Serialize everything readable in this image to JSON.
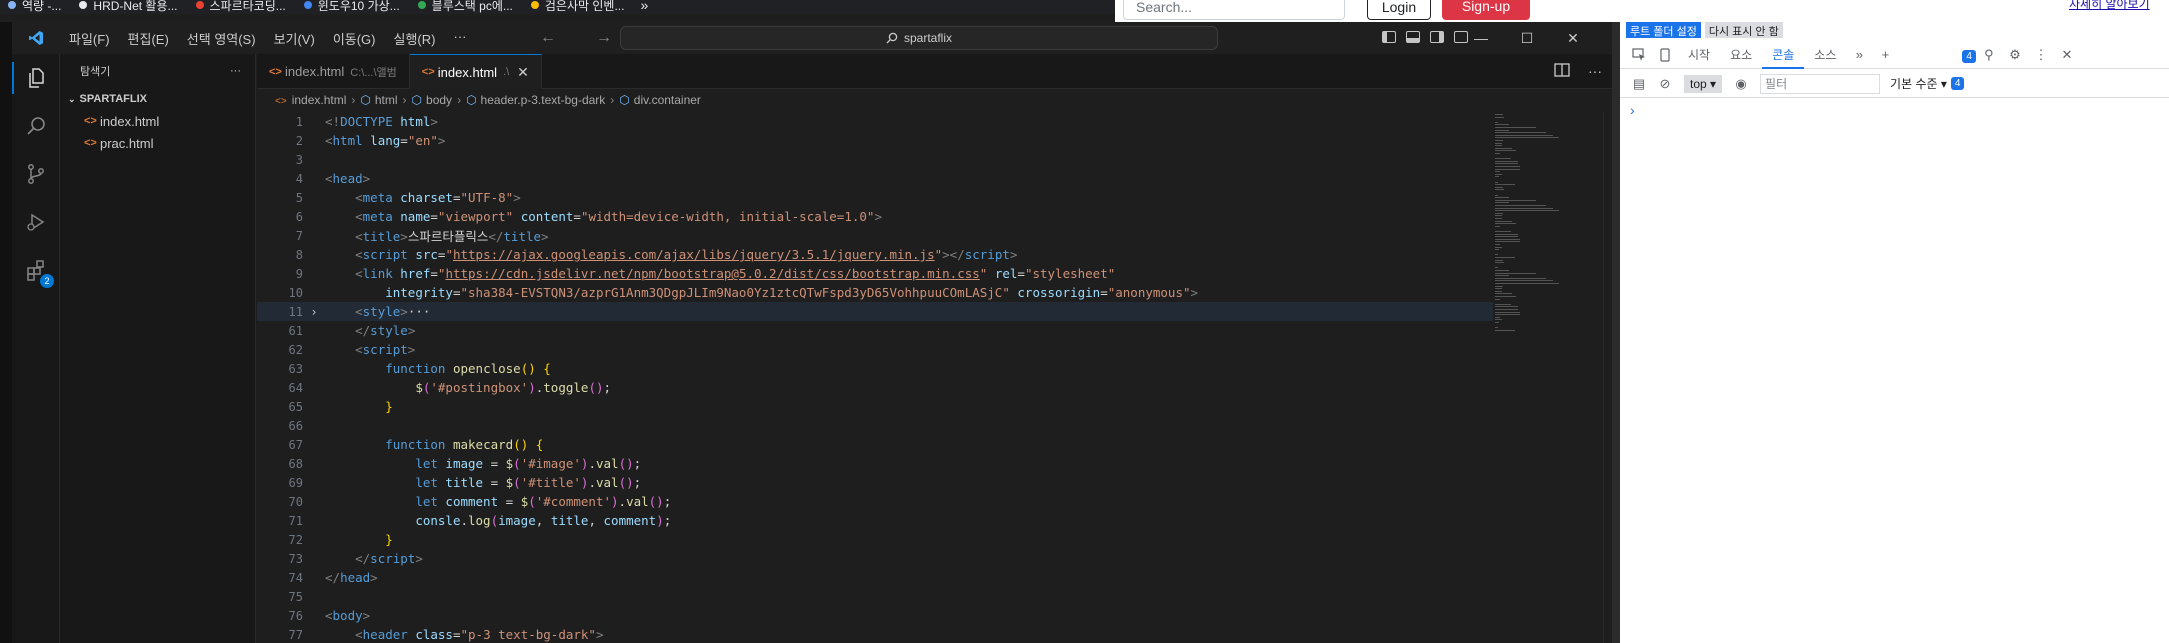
{
  "browser": {
    "bookmarks": [
      {
        "label": "역량 -...",
        "color": "#8ab4f8"
      },
      {
        "label": "HRD-Net 활용...",
        "color": "#e8eaed"
      },
      {
        "label": "스파르타코딩...",
        "color": "#ea4335"
      },
      {
        "label": "윈도우10 가상...",
        "color": "#4285f4"
      },
      {
        "label": "블루스택 pc에...",
        "color": "#34a853"
      },
      {
        "label": "검은사막 인벤...",
        "color": "#fbbc04"
      }
    ],
    "bookmarks_more": "»"
  },
  "webpage": {
    "search_placeholder": "Search...",
    "login_label": "Login",
    "signup_label": "Sign-up",
    "learn_more": "자세히 알아보기"
  },
  "vscode": {
    "menu": [
      "파일(F)",
      "편집(E)",
      "선택 영역(S)",
      "보기(V)",
      "이동(G)",
      "실행(R)",
      "···"
    ],
    "command_center": "spartaflix",
    "window_controls": [
      "—",
      "☐",
      "✕"
    ],
    "extensions_badge": "2",
    "sidebar": {
      "title": "탐색기",
      "more": "···",
      "folder": "SPARTAFLIX",
      "files": [
        "index.html",
        "prac.html"
      ]
    },
    "tabs": [
      {
        "label": "index.html",
        "desc": "C:\\...\\앨범",
        "active": false
      },
      {
        "label": "index.html",
        "desc": ".\\",
        "active": true
      }
    ],
    "tab_close": "✕",
    "breadcrumb": [
      "index.html",
      "html",
      "body",
      "header.p-3.text-bg-dark",
      "div.container"
    ],
    "code_lines": [
      {
        "n": "1",
        "fold": "",
        "hl": false,
        "parts": [
          [
            "t-brk",
            "<!"
          ],
          [
            "t-tag",
            "DOCTYPE"
          ],
          [
            "t-txt",
            " "
          ],
          [
            "t-attr",
            "html"
          ],
          [
            "t-brk",
            ">"
          ]
        ]
      },
      {
        "n": "2",
        "fold": "",
        "hl": false,
        "parts": [
          [
            "t-brk",
            "<"
          ],
          [
            "t-tag",
            "html"
          ],
          [
            "t-txt",
            " "
          ],
          [
            "t-attr",
            "lang"
          ],
          [
            "t-txt",
            "="
          ],
          [
            "t-str",
            "\"en\""
          ],
          [
            "t-brk",
            ">"
          ]
        ]
      },
      {
        "n": "3",
        "fold": "",
        "hl": false,
        "parts": []
      },
      {
        "n": "4",
        "fold": "",
        "hl": false,
        "parts": [
          [
            "t-brk",
            "<"
          ],
          [
            "t-tag",
            "head"
          ],
          [
            "t-brk",
            ">"
          ]
        ]
      },
      {
        "n": "5",
        "fold": "",
        "hl": false,
        "parts": [
          [
            "t-txt",
            "    "
          ],
          [
            "t-brk",
            "<"
          ],
          [
            "t-tag",
            "meta"
          ],
          [
            "t-txt",
            " "
          ],
          [
            "t-attr",
            "charset"
          ],
          [
            "t-txt",
            "="
          ],
          [
            "t-str",
            "\"UTF-8\""
          ],
          [
            "t-brk",
            ">"
          ]
        ]
      },
      {
        "n": "6",
        "fold": "",
        "hl": false,
        "parts": [
          [
            "t-txt",
            "    "
          ],
          [
            "t-brk",
            "<"
          ],
          [
            "t-tag",
            "meta"
          ],
          [
            "t-txt",
            " "
          ],
          [
            "t-attr",
            "name"
          ],
          [
            "t-txt",
            "="
          ],
          [
            "t-str",
            "\"viewport\""
          ],
          [
            "t-txt",
            " "
          ],
          [
            "t-attr",
            "content"
          ],
          [
            "t-txt",
            "="
          ],
          [
            "t-str",
            "\"width=device-width, initial-scale=1.0\""
          ],
          [
            "t-brk",
            ">"
          ]
        ]
      },
      {
        "n": "7",
        "fold": "",
        "hl": false,
        "parts": [
          [
            "t-txt",
            "    "
          ],
          [
            "t-brk",
            "<"
          ],
          [
            "t-tag",
            "title"
          ],
          [
            "t-brk",
            ">"
          ],
          [
            "t-txt",
            "스파르타플릭스"
          ],
          [
            "t-brk",
            "</"
          ],
          [
            "t-tag",
            "title"
          ],
          [
            "t-brk",
            ">"
          ]
        ]
      },
      {
        "n": "8",
        "fold": "",
        "hl": false,
        "parts": [
          [
            "t-txt",
            "    "
          ],
          [
            "t-brk",
            "<"
          ],
          [
            "t-tag",
            "script"
          ],
          [
            "t-txt",
            " "
          ],
          [
            "t-attr",
            "src"
          ],
          [
            "t-txt",
            "="
          ],
          [
            "t-str",
            "\""
          ],
          [
            "t-url",
            "https://ajax.googleapis.com/ajax/libs/jquery/3.5.1/jquery.min.js"
          ],
          [
            "t-str",
            "\""
          ],
          [
            "t-brk",
            "></"
          ],
          [
            "t-tag",
            "script"
          ],
          [
            "t-brk",
            ">"
          ]
        ]
      },
      {
        "n": "9",
        "fold": "",
        "hl": false,
        "parts": [
          [
            "t-txt",
            "    "
          ],
          [
            "t-brk",
            "<"
          ],
          [
            "t-tag",
            "link"
          ],
          [
            "t-txt",
            " "
          ],
          [
            "t-attr",
            "href"
          ],
          [
            "t-txt",
            "="
          ],
          [
            "t-str",
            "\""
          ],
          [
            "t-url",
            "https://cdn.jsdelivr.net/npm/bootstrap@5.0.2/dist/css/bootstrap.min.css"
          ],
          [
            "t-str",
            "\""
          ],
          [
            "t-txt",
            " "
          ],
          [
            "t-attr",
            "rel"
          ],
          [
            "t-txt",
            "="
          ],
          [
            "t-str",
            "\"stylesheet\""
          ]
        ]
      },
      {
        "n": "10",
        "fold": "",
        "hl": false,
        "parts": [
          [
            "t-txt",
            "        "
          ],
          [
            "t-attr",
            "integrity"
          ],
          [
            "t-txt",
            "="
          ],
          [
            "t-str",
            "\"sha384-EVSTQN3/azprG1Anm3QDgpJLIm9Nao0Yz1ztcQTwFspd3yD65VohhpuuCOmLASjC\""
          ],
          [
            "t-txt",
            " "
          ],
          [
            "t-attr",
            "crossorigin"
          ],
          [
            "t-txt",
            "="
          ],
          [
            "t-str",
            "\"anonymous\""
          ],
          [
            "t-brk",
            ">"
          ]
        ]
      },
      {
        "n": "11",
        "fold": "›",
        "hl": true,
        "parts": [
          [
            "t-txt",
            "    "
          ],
          [
            "t-brk",
            "<"
          ],
          [
            "t-tag",
            "style"
          ],
          [
            "t-brk",
            ">"
          ],
          [
            "t-txt",
            "···"
          ]
        ]
      },
      {
        "n": "61",
        "fold": "",
        "hl": false,
        "parts": [
          [
            "t-txt",
            "    "
          ],
          [
            "t-brk",
            "</"
          ],
          [
            "t-tag",
            "style"
          ],
          [
            "t-brk",
            ">"
          ]
        ]
      },
      {
        "n": "62",
        "fold": "",
        "hl": false,
        "parts": [
          [
            "t-txt",
            "    "
          ],
          [
            "t-brk",
            "<"
          ],
          [
            "t-tag",
            "script"
          ],
          [
            "t-brk",
            ">"
          ]
        ]
      },
      {
        "n": "63",
        "fold": "",
        "hl": false,
        "parts": [
          [
            "t-txt",
            "        "
          ],
          [
            "t-kw",
            "function"
          ],
          [
            "t-txt",
            " "
          ],
          [
            "t-fn",
            "openclose"
          ],
          [
            "t-p1",
            "()"
          ],
          [
            "t-txt",
            " "
          ],
          [
            "t-p1",
            "{"
          ]
        ]
      },
      {
        "n": "64",
        "fold": "",
        "hl": false,
        "parts": [
          [
            "t-txt",
            "            "
          ],
          [
            "t-fn",
            "$"
          ],
          [
            "t-p2",
            "("
          ],
          [
            "t-str",
            "'#postingbox'"
          ],
          [
            "t-p2",
            ")"
          ],
          [
            "t-txt",
            "."
          ],
          [
            "t-fn",
            "toggle"
          ],
          [
            "t-p2",
            "()"
          ],
          [
            "t-txt",
            ";"
          ]
        ]
      },
      {
        "n": "65",
        "fold": "",
        "hl": false,
        "parts": [
          [
            "t-txt",
            "        "
          ],
          [
            "t-p1",
            "}"
          ]
        ]
      },
      {
        "n": "66",
        "fold": "",
        "hl": false,
        "parts": []
      },
      {
        "n": "67",
        "fold": "",
        "hl": false,
        "parts": [
          [
            "t-txt",
            "        "
          ],
          [
            "t-kw",
            "function"
          ],
          [
            "t-txt",
            " "
          ],
          [
            "t-fn",
            "makecard"
          ],
          [
            "t-p1",
            "()"
          ],
          [
            "t-txt",
            " "
          ],
          [
            "t-p1",
            "{"
          ]
        ]
      },
      {
        "n": "68",
        "fold": "",
        "hl": false,
        "parts": [
          [
            "t-txt",
            "            "
          ],
          [
            "t-kw",
            "let"
          ],
          [
            "t-txt",
            " "
          ],
          [
            "t-var",
            "image"
          ],
          [
            "t-txt",
            " = "
          ],
          [
            "t-fn",
            "$"
          ],
          [
            "t-p2",
            "("
          ],
          [
            "t-str",
            "'#image'"
          ],
          [
            "t-p2",
            ")"
          ],
          [
            "t-txt",
            "."
          ],
          [
            "t-fn",
            "val"
          ],
          [
            "t-p2",
            "()"
          ],
          [
            "t-txt",
            ";"
          ]
        ]
      },
      {
        "n": "69",
        "fold": "",
        "hl": false,
        "parts": [
          [
            "t-txt",
            "            "
          ],
          [
            "t-kw",
            "let"
          ],
          [
            "t-txt",
            " "
          ],
          [
            "t-var",
            "title"
          ],
          [
            "t-txt",
            " = "
          ],
          [
            "t-fn",
            "$"
          ],
          [
            "t-p2",
            "("
          ],
          [
            "t-str",
            "'#title'"
          ],
          [
            "t-p2",
            ")"
          ],
          [
            "t-txt",
            "."
          ],
          [
            "t-fn",
            "val"
          ],
          [
            "t-p2",
            "()"
          ],
          [
            "t-txt",
            ";"
          ]
        ]
      },
      {
        "n": "70",
        "fold": "",
        "hl": false,
        "parts": [
          [
            "t-txt",
            "            "
          ],
          [
            "t-kw",
            "let"
          ],
          [
            "t-txt",
            " "
          ],
          [
            "t-var",
            "comment"
          ],
          [
            "t-txt",
            " = "
          ],
          [
            "t-fn",
            "$"
          ],
          [
            "t-p2",
            "("
          ],
          [
            "t-str",
            "'#comment'"
          ],
          [
            "t-p2",
            ")"
          ],
          [
            "t-txt",
            "."
          ],
          [
            "t-fn",
            "val"
          ],
          [
            "t-p2",
            "()"
          ],
          [
            "t-txt",
            ";"
          ]
        ]
      },
      {
        "n": "71",
        "fold": "",
        "hl": false,
        "parts": [
          [
            "t-txt",
            "            "
          ],
          [
            "t-var",
            "consle"
          ],
          [
            "t-txt",
            "."
          ],
          [
            "t-fn",
            "log"
          ],
          [
            "t-p2",
            "("
          ],
          [
            "t-var",
            "image"
          ],
          [
            "t-txt",
            ", "
          ],
          [
            "t-var",
            "title"
          ],
          [
            "t-txt",
            ", "
          ],
          [
            "t-var",
            "comment"
          ],
          [
            "t-p2",
            ")"
          ],
          [
            "t-txt",
            ";"
          ]
        ]
      },
      {
        "n": "72",
        "fold": "",
        "hl": false,
        "parts": [
          [
            "t-txt",
            "        "
          ],
          [
            "t-p1",
            "}"
          ]
        ]
      },
      {
        "n": "73",
        "fold": "",
        "hl": false,
        "parts": [
          [
            "t-txt",
            "    "
          ],
          [
            "t-brk",
            "</"
          ],
          [
            "t-tag",
            "script"
          ],
          [
            "t-brk",
            ">"
          ]
        ]
      },
      {
        "n": "74",
        "fold": "",
        "hl": false,
        "parts": [
          [
            "t-brk",
            "</"
          ],
          [
            "t-tag",
            "head"
          ],
          [
            "t-brk",
            ">"
          ]
        ]
      },
      {
        "n": "75",
        "fold": "",
        "hl": false,
        "parts": []
      },
      {
        "n": "76",
        "fold": "",
        "hl": false,
        "parts": [
          [
            "t-brk",
            "<"
          ],
          [
            "t-tag",
            "body"
          ],
          [
            "t-brk",
            ">"
          ]
        ]
      },
      {
        "n": "77",
        "fold": "",
        "hl": false,
        "parts": [
          [
            "t-txt",
            "    "
          ],
          [
            "t-brk",
            "<"
          ],
          [
            "t-tag",
            "header"
          ],
          [
            "t-txt",
            " "
          ],
          [
            "t-attr",
            "class"
          ],
          [
            "t-txt",
            "="
          ],
          [
            "t-str",
            "\"p-3 text-bg-dark\""
          ],
          [
            "t-brk",
            ">"
          ]
        ]
      }
    ]
  },
  "devtools": {
    "root_folder_button": "루트 폴더 설정",
    "dont_show_button": "다시 표시 안 함",
    "tabs": [
      "시작",
      "요소",
      "콘솔",
      "소스"
    ],
    "active_tab": "콘솔",
    "issues_count": "4",
    "context_select": "top",
    "filter_placeholder": "필터",
    "levels_label": "기본 수준",
    "levels_badge": "4",
    "prompt": "›",
    "accent": "#1a73e8"
  }
}
